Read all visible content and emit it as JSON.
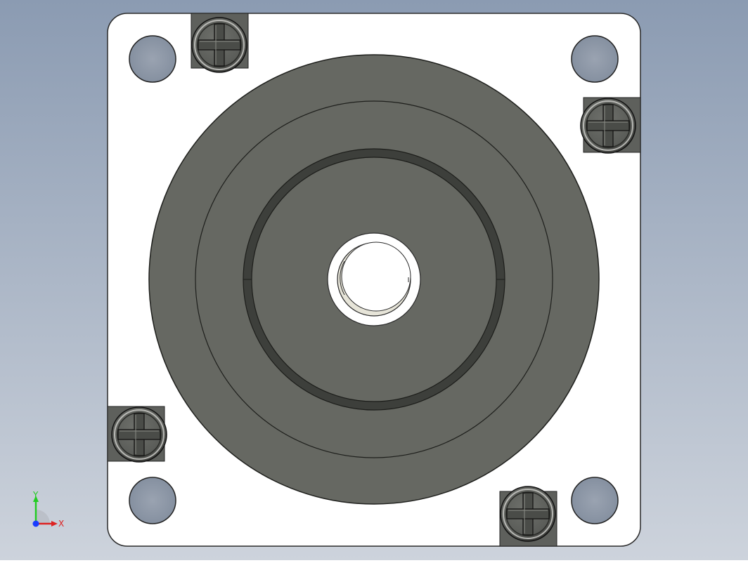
{
  "viewport": {
    "background_top": "#8b9bb2",
    "background_bottom": "#cdd3dc"
  },
  "part": {
    "plate_color": "#ffffff",
    "plate_edge": "#2a2a2a",
    "hole_color": "#8f98a6",
    "boss_color": "#666862",
    "groove_color": "#3d3f3b",
    "bore_color": "#ffffff",
    "bore_ring_color": "#e6e4d8",
    "screw_color": "#5e605c"
  },
  "triad": {
    "y_label": "Y",
    "x_label": "X",
    "y_color": "#22cc22",
    "x_color": "#dd2222",
    "z_color": "#1a3cff"
  }
}
